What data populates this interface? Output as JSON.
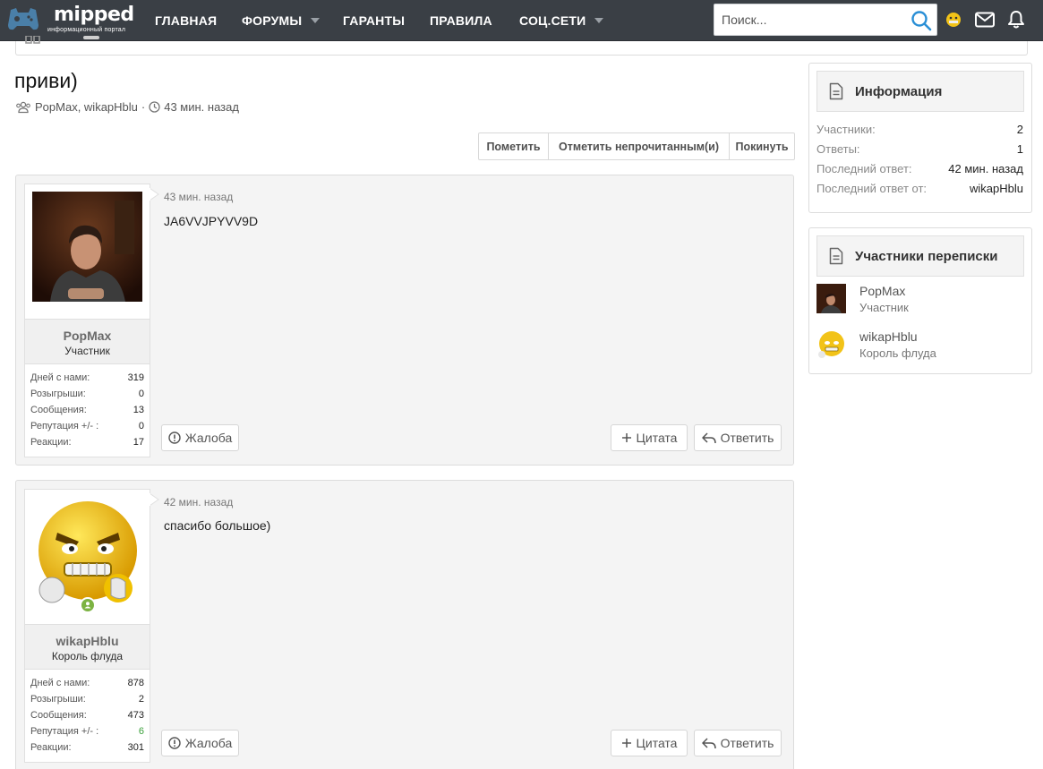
{
  "header": {
    "logo_text": "mipped",
    "logo_subtitle": "информационный портал",
    "nav": [
      {
        "label": "ГЛАВНАЯ"
      },
      {
        "label": "ФОРУМЫ"
      },
      {
        "label": "ГАРАНТЫ"
      },
      {
        "label": "ПРАВИЛА"
      },
      {
        "label": "СОЦ.СЕТИ"
      }
    ],
    "search_placeholder": "Поиск...",
    "icons": [
      "avatar",
      "envelope-icon",
      "bell-icon",
      "search-icon"
    ],
    "accent": "#3a3f45"
  },
  "thread": {
    "title": "приви)",
    "participants_text": "PopMax, wikapHblu",
    "separator": "·",
    "time_text": "43 мин. назад",
    "actions": [
      "Пометить",
      "Отметить непрочитанным(и)",
      "Покинуть"
    ]
  },
  "posts": [
    {
      "user": "PopMax",
      "role": "Участник",
      "stats": [
        {
          "label": "Дней с нами:",
          "value": "319"
        },
        {
          "label": "Розыгрыши:",
          "value": "0"
        },
        {
          "label": "Сообщения:",
          "value": "13"
        },
        {
          "label": "Репутация +/- :",
          "value": "0"
        },
        {
          "label": "Реакции:",
          "value": "17"
        }
      ],
      "time": "43 мин. назад",
      "body": "JA6VVJPYVV9D",
      "report": "Жалоба",
      "quote": "Цитата",
      "reply": "Ответить"
    },
    {
      "user": "wikapHblu",
      "role": "Король флуда",
      "stats": [
        {
          "label": "Дней с нами:",
          "value": "878"
        },
        {
          "label": "Розыгрыши:",
          "value": "2"
        },
        {
          "label": "Сообщения:",
          "value": "473"
        },
        {
          "label": "Репутация +/- :",
          "value": "6"
        },
        {
          "label": "Реакции:",
          "value": "301"
        }
      ],
      "time": "42 мин. назад",
      "body": "спасибо большое)",
      "report": "Жалоба",
      "quote": "Цитата",
      "reply": "Ответить",
      "online_color": "#7cb342"
    }
  ],
  "sidebar": {
    "info_title": "Информация",
    "info_rows": [
      {
        "label": "Участники:",
        "value": "2"
      },
      {
        "label": "Ответы:",
        "value": "1"
      },
      {
        "label": "Последний ответ:",
        "value": "42 мин. назад"
      },
      {
        "label": "Последний ответ от:",
        "value": "wikapHblu"
      }
    ],
    "participants_title": "Участники переписки",
    "participants": [
      {
        "name": "PopMax",
        "role": "Участник"
      },
      {
        "name": "wikapHblu",
        "role": "Король флуда"
      }
    ]
  }
}
